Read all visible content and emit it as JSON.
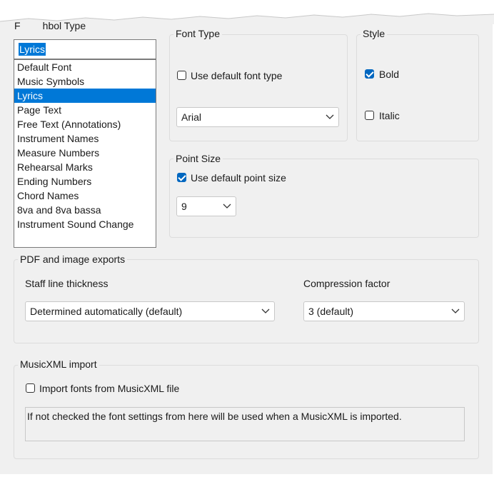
{
  "symbol_type": {
    "label_partial": "hbol Type",
    "selected_value": "Lyrics",
    "items": [
      "Default Font",
      "Music Symbols",
      "Lyrics",
      "Page Text",
      "Free Text (Annotations)",
      "Instrument Names",
      "Measure Numbers",
      "Rehearsal Marks",
      "Ending Numbers",
      "Chord Names",
      "8va and 8va bassa",
      "Instrument Sound Change"
    ],
    "selected_index": 2
  },
  "font_type": {
    "group_label": "Font Type",
    "use_default_label": "Use default font type",
    "use_default_checked": false,
    "font_value": "Arial"
  },
  "style": {
    "group_label": "Style",
    "bold_label": "Bold",
    "bold_checked": true,
    "italic_label": "Italic",
    "italic_checked": false
  },
  "point_size": {
    "group_label": "Point Size",
    "use_default_label": "Use default point size",
    "use_default_checked": true,
    "size_value": "9"
  },
  "pdf_exports": {
    "group_label": "PDF and image exports",
    "staff_label": "Staff line thickness",
    "staff_value": "Determined automatically (default)",
    "compression_label": "Compression factor",
    "compression_value": "3  (default)"
  },
  "musicxml": {
    "group_label": "MusicXML import",
    "import_label": "Import fonts from MusicXML file",
    "import_checked": false,
    "note": "If not checked the font settings from here will be used when a MusicXML is imported."
  },
  "colors": {
    "accent": "#0067c0",
    "selection": "#0078d7",
    "dialog_bg": "#f0f0f0"
  }
}
